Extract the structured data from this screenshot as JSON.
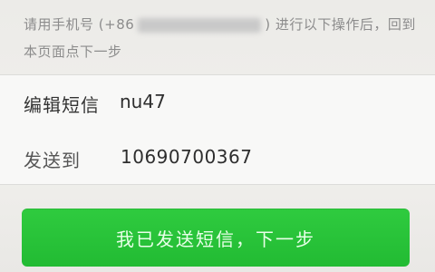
{
  "instruction": {
    "prefix": "请用手机号 (+86",
    "suffix": ") 进行以下操作后，回到本页面点下一步"
  },
  "form": {
    "sms_label": "编辑短信",
    "sms_content": "nu47",
    "send_to_label": "发送到",
    "send_to_number": "10690700367"
  },
  "actions": {
    "next_label": "我已发送短信，下一步",
    "accent_color": "#29c23a"
  }
}
